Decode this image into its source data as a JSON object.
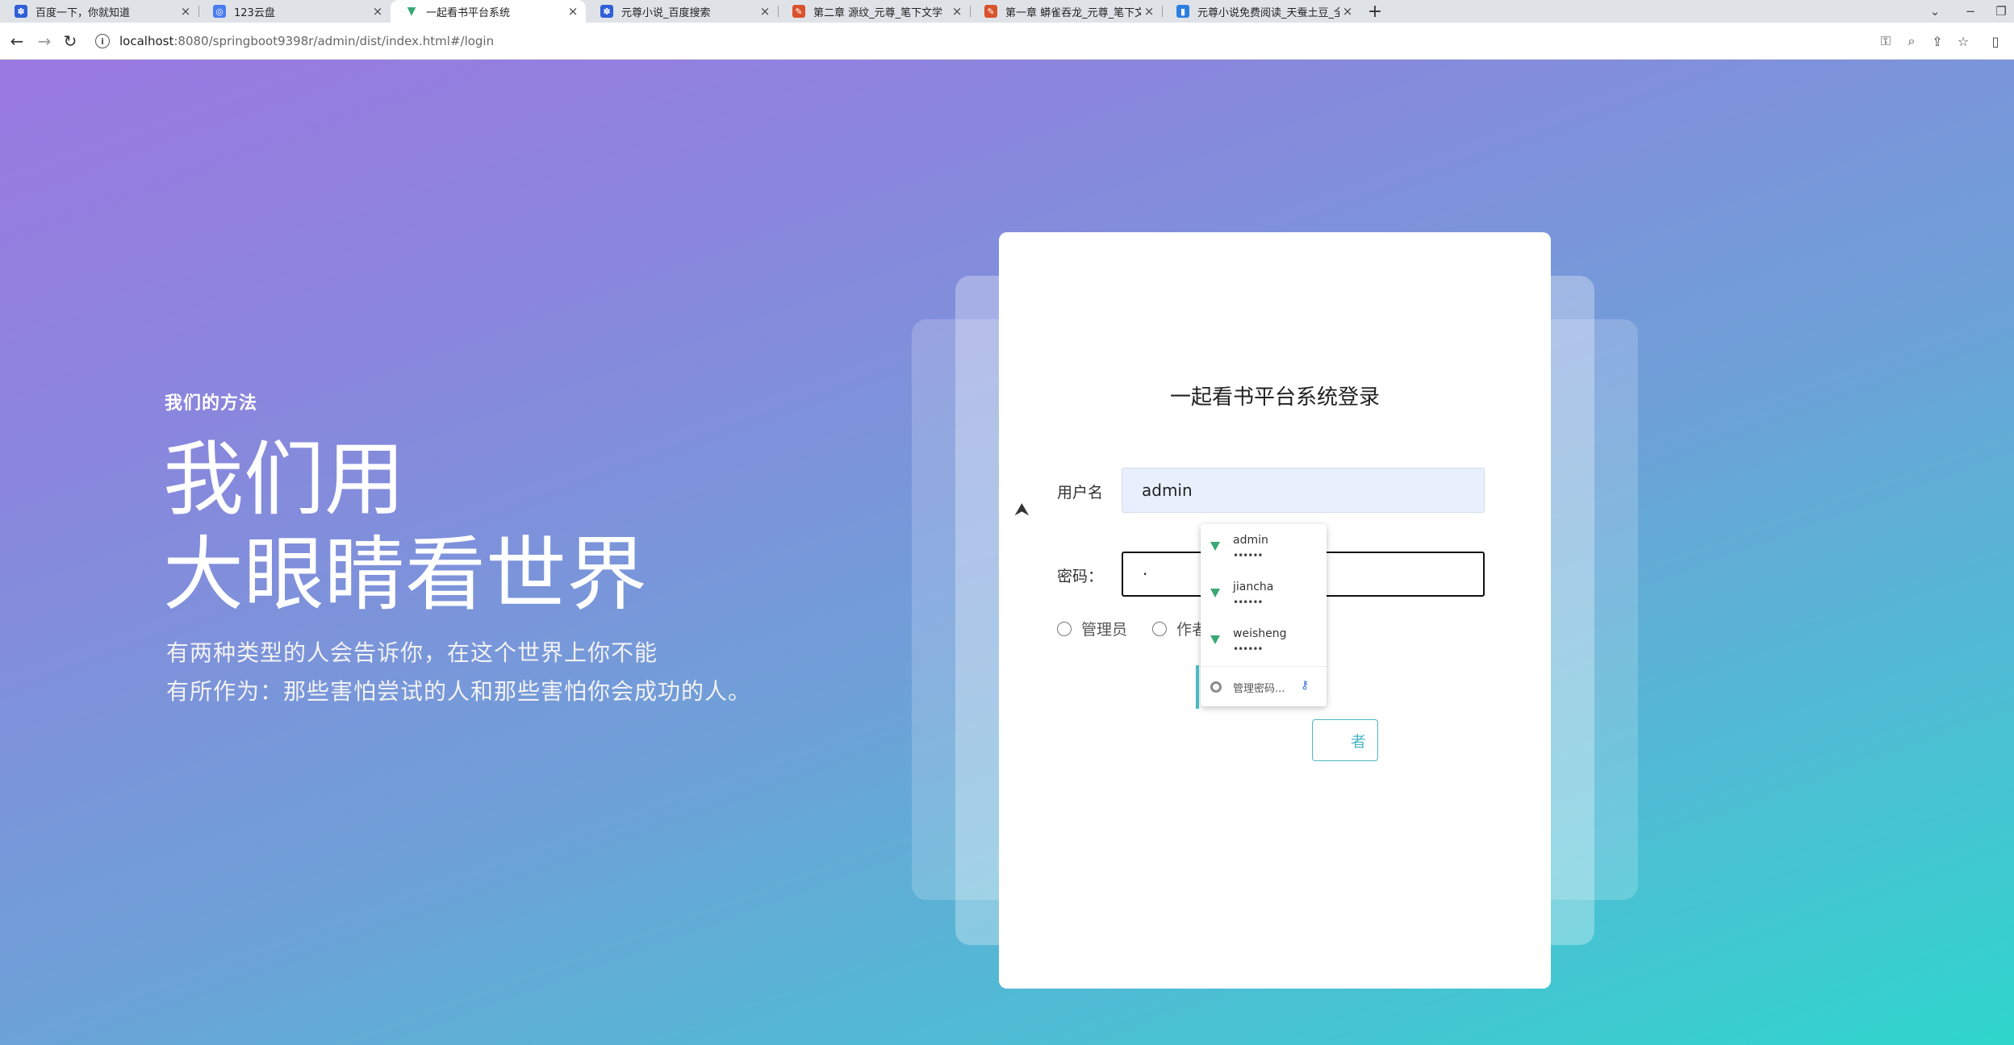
{
  "browser": {
    "tabs": [
      {
        "title": "百度一下，你就知道",
        "active": false
      },
      {
        "title": "123云盘",
        "active": false
      },
      {
        "title": "一起看书平台系统",
        "active": true
      },
      {
        "title": "元尊小说_百度搜索",
        "active": false
      },
      {
        "title": "第二章 源纹_元尊_笔下文学",
        "active": false
      },
      {
        "title": "第一章 蟒雀吞龙_元尊_笔下文学",
        "active": false
      },
      {
        "title": "元尊小说免费阅读_天蚕土豆_全",
        "active": false
      }
    ],
    "url_host": "localhost",
    "url_path": ":8080/springboot9398r/admin/dist/index.html#/login",
    "icons": {
      "back": "back-arrow-icon",
      "forward": "forward-arrow-icon",
      "reload": "reload-icon",
      "info": "info-icon",
      "key": "key-icon",
      "zoom": "zoom-icon",
      "share": "share-icon",
      "star": "bookmark-star-icon",
      "sidepanel": "side-panel-icon",
      "new_tab": "plus-icon"
    }
  },
  "hero": {
    "kicker": "我们的方法",
    "title_line1": "我们用",
    "title_line2": "大眼睛看世界",
    "sub_line1": "有两种类型的人会告诉你，在这个世界上你不能",
    "sub_line2": "有所作为：那些害怕尝试的人和那些害怕你会成功的人。"
  },
  "login": {
    "title": "一起看书平台系统登录",
    "username_label": "用户名",
    "username_value": "admin",
    "password_label": "密码：",
    "password_value": "·",
    "roles": [
      {
        "label": "管理员",
        "checked": false
      },
      {
        "label": "作者",
        "checked": false
      }
    ],
    "partial_button_label": "者"
  },
  "autofill": {
    "accounts": [
      {
        "username": "admin",
        "password": "••••••"
      },
      {
        "username": "jiancha",
        "password": "••••••"
      },
      {
        "username": "weisheng",
        "password": "••••••"
      }
    ],
    "manage_label": "管理密码...",
    "colors": {
      "vue_green": "#3aa776",
      "accent": "#4cb8c4"
    }
  },
  "colors": {
    "gradient_start": "#9a79e0",
    "gradient_end": "#2fd6cc"
  }
}
